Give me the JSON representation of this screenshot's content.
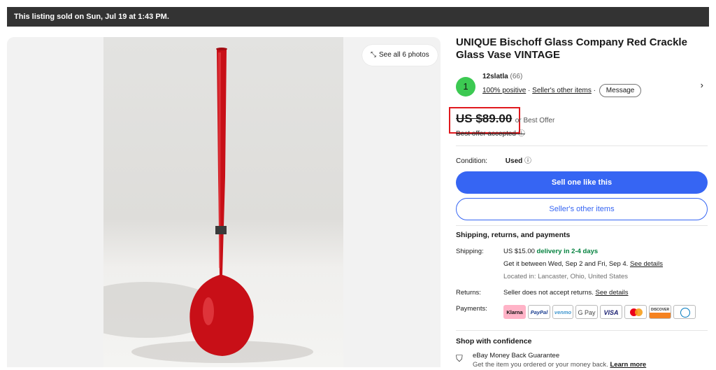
{
  "banner": {
    "text": "This listing sold on Sun, Jul 19 at 1:43 PM."
  },
  "gallery": {
    "see_all": "See all 6 photos"
  },
  "listing": {
    "title": "UNIQUE Bischoff Glass Company Red Crackle Glass Vase VINTAGE"
  },
  "seller": {
    "avatar_letter": "1",
    "name": "12slatla",
    "feedback_count": "(66)",
    "positive": "100% positive",
    "sep1": "·",
    "other_items": "Seller's other items",
    "sep2": "·",
    "message": "Message"
  },
  "price": {
    "amount": "US $89.00",
    "best_offer": "or Best Offer",
    "accepted": "Best offer accepted"
  },
  "condition": {
    "label": "Condition:",
    "value": "Used"
  },
  "buttons": {
    "sell_one": "Sell one like this",
    "other_items": "Seller's other items"
  },
  "shipping_section": {
    "heading": "Shipping, returns, and payments",
    "shipping_label": "Shipping:",
    "shipping_cost": "US $15.00",
    "delivery": "delivery in 2-4 days",
    "window": "Get it between Wed, Sep 2 and Fri, Sep 4.",
    "see_details": "See details",
    "located": "Located in: Lancaster, Ohio, United States",
    "returns_label": "Returns:",
    "returns_text": "Seller does not accept returns.",
    "returns_details": "See details",
    "payments_label": "Payments:",
    "payment_methods": [
      "Klarna",
      "PayPal",
      "venmo",
      "G Pay",
      "VISA",
      "Mastercard",
      "DISCOVER",
      "Diners"
    ]
  },
  "confidence": {
    "heading": "Shop with confidence",
    "guarantee": "eBay Money Back Guarantee",
    "guarantee_text": "Get the item you ordered or your money back.",
    "learn_more": "Learn more"
  }
}
